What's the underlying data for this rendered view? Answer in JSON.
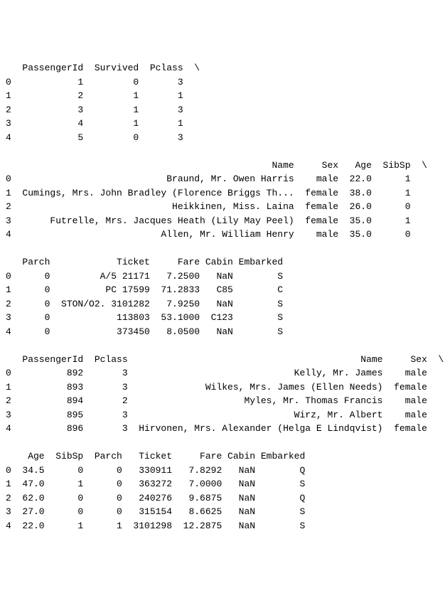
{
  "blocks": [
    {
      "header": "   PassengerId  Survived  Pclass  \\",
      "rows": [
        "0            1         0       3",
        "1            2         1       1",
        "2            3         1       3",
        "3            4         1       1",
        "4            5         0       3"
      ]
    },
    {
      "header": "                                                Name     Sex   Age  SibSp  \\",
      "rows": [
        "0                            Braund, Mr. Owen Harris    male  22.0      1",
        "1  Cumings, Mrs. John Bradley (Florence Briggs Th...  female  38.0      1",
        "2                             Heikkinen, Miss. Laina  female  26.0      0",
        "3       Futrelle, Mrs. Jacques Heath (Lily May Peel)  female  35.0      1",
        "4                           Allen, Mr. William Henry    male  35.0      0"
      ]
    },
    {
      "header": "   Parch            Ticket     Fare Cabin Embarked",
      "rows": [
        "0      0         A/5 21171   7.2500   NaN        S",
        "1      0          PC 17599  71.2833   C85        C",
        "2      0  STON/O2. 3101282   7.9250   NaN        S",
        "3      0            113803  53.1000  C123        S",
        "4      0            373450   8.0500   NaN        S"
      ]
    },
    {
      "header": "   PassengerId  Pclass                                          Name     Sex  \\",
      "rows": [
        "0          892       3                              Kelly, Mr. James    male",
        "1          893       3              Wilkes, Mrs. James (Ellen Needs)  female",
        "2          894       2                     Myles, Mr. Thomas Francis    male",
        "3          895       3                              Wirz, Mr. Albert    male",
        "4          896       3  Hirvonen, Mrs. Alexander (Helga E Lindqvist)  female"
      ]
    },
    {
      "header": "    Age  SibSp  Parch   Ticket     Fare Cabin Embarked",
      "rows": [
        "0  34.5      0      0   330911   7.8292   NaN        Q",
        "1  47.0      1      0   363272   7.0000   NaN        S",
        "2  62.0      0      0   240276   9.6875   NaN        Q",
        "3  27.0      0      0   315154   8.6625   NaN        S",
        "4  22.0      1      1  3101298  12.2875   NaN        S"
      ]
    }
  ]
}
